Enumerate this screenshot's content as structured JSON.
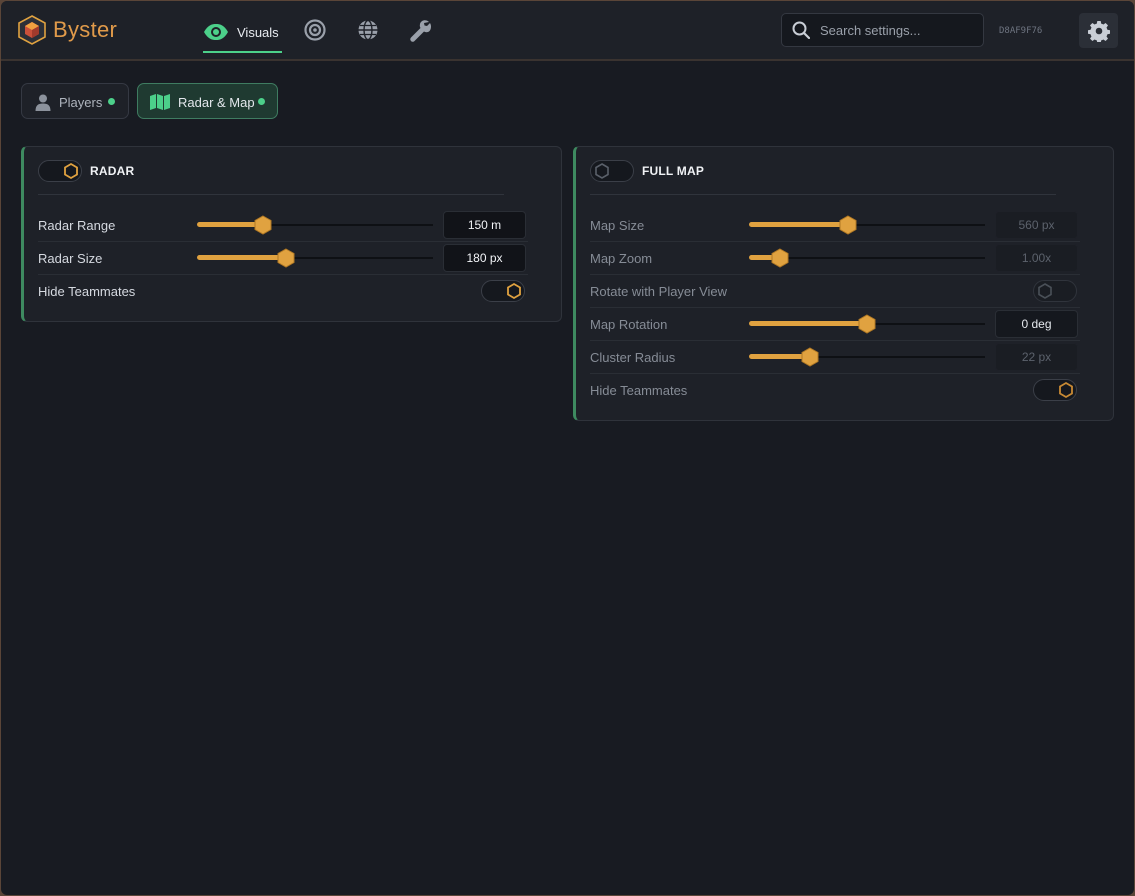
{
  "app": {
    "brand": "Byster",
    "hwid": "D8AF9F76",
    "colors": {
      "accent": "#e0a240",
      "active_green": "#4cd08a",
      "background": "#181b22"
    }
  },
  "nav": {
    "tabs": [
      {
        "label": "Visuals",
        "icon": "eye-icon",
        "active": true
      },
      {
        "label": "",
        "icon": "target-icon",
        "active": false
      },
      {
        "label": "",
        "icon": "globe-icon",
        "active": false
      },
      {
        "label": "",
        "icon": "wrench-icon",
        "active": false
      }
    ]
  },
  "search": {
    "placeholder": "Search settings..."
  },
  "subtabs": [
    {
      "label": "Players",
      "icon": "user-icon",
      "active": false
    },
    {
      "label": "Radar & Map",
      "icon": "map-icon",
      "active": true
    }
  ],
  "radar": {
    "title": "RADAR",
    "enabled": true,
    "rows": [
      {
        "label": "Radar Range",
        "value": "150 m",
        "fill": 0.28
      },
      {
        "label": "Radar Size",
        "value": "180 px",
        "fill": 0.375
      },
      {
        "label": "Hide Teammates",
        "toggle": true
      }
    ]
  },
  "fullmap": {
    "title": "FULL MAP",
    "enabled": false,
    "rows": [
      {
        "label": "Map Size",
        "value": "560 px",
        "fill": 0.42
      },
      {
        "label": "Map Zoom",
        "value": "1.00x",
        "fill": 0.13
      },
      {
        "label": "Rotate with Player View",
        "toggle": false
      },
      {
        "label": "Map Rotation",
        "value": "0 deg",
        "fill": 0.5
      },
      {
        "label": "Cluster Radius",
        "value": "22 px",
        "fill": 0.26
      },
      {
        "label": "Hide Teammates",
        "toggle": true
      }
    ]
  }
}
